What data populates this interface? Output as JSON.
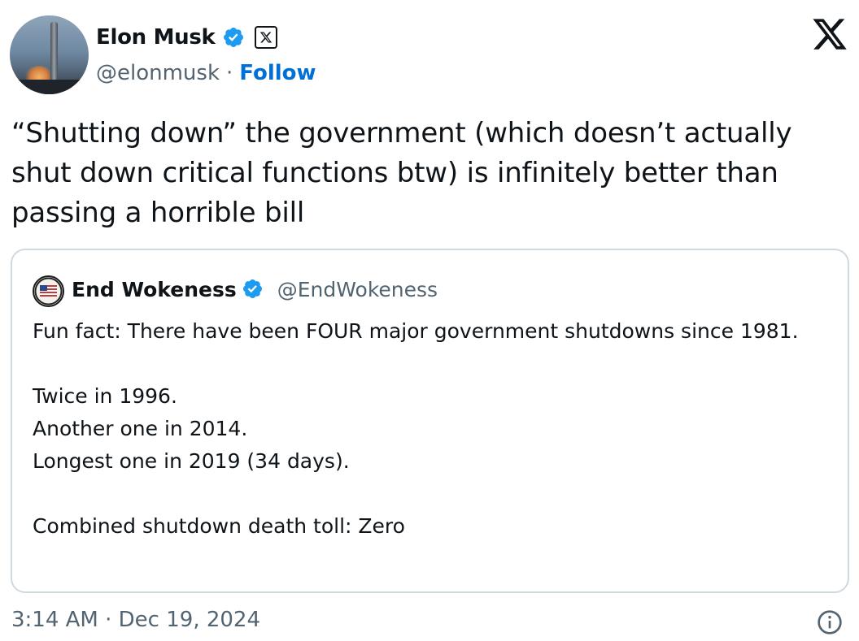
{
  "author": {
    "display_name": "Elon Musk",
    "handle": "@elonmusk",
    "separator": "·",
    "follow_label": "Follow",
    "verified_icon": "verified-badge-icon",
    "affiliation_icon": "x-affiliation-icon"
  },
  "brand_icon": "x-logo-icon",
  "tweet": {
    "text": "“Shutting down” the government (which doesn’t actually shut down critical functions btw) is infinitely better than passing a horrible bill"
  },
  "quoted_tweet": {
    "display_name": "End Wokeness",
    "handle": "@EndWokeness",
    "lines": {
      "l1": "Fun fact: There have been FOUR major government shutdowns since 1981.",
      "l2": "Twice in 1996.",
      "l3": "Another one in 2014.",
      "l4": "Longest one in 2019 (34 days).",
      "l5": "Combined shutdown death toll: Zero"
    }
  },
  "footer": {
    "timestamp": "3:14 AM · Dec 19, 2024",
    "info_icon": "info-icon"
  },
  "colors": {
    "text": "#0f1419",
    "secondary": "#536471",
    "link": "#006fd6",
    "verified": "#1d9bf0",
    "border": "#cfd9de"
  }
}
